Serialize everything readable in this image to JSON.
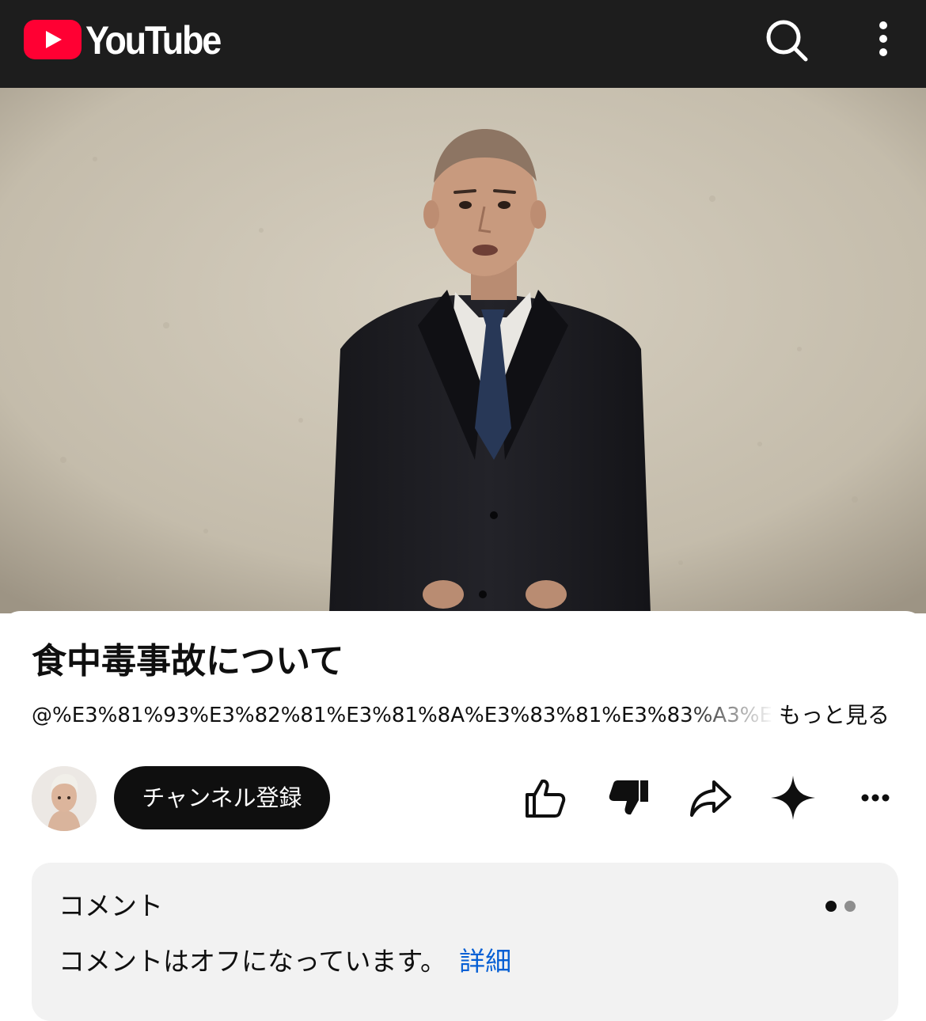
{
  "app": {
    "name": "YouTube",
    "brand_color": "#ff0033",
    "icons": [
      "youtube-play-icon",
      "search-icon",
      "more-vert-icon"
    ]
  },
  "video": {
    "title": "食中毒事故について",
    "channel_handle": "@%E3%81%93%E3%82%81%E3%81%8A%E3%83%81%E3%83%A3%E3",
    "more_label": "もっと見る"
  },
  "actions": {
    "subscribe_label": "チャンネル登録",
    "subscribe_color": "#0f0f0f",
    "icons": [
      "thumbs-up-icon",
      "thumbs-down-icon",
      "share-icon",
      "sparkle-icon",
      "more-horiz-icon"
    ]
  },
  "comments": {
    "heading": "コメント",
    "off_message": "コメントはオフになっています。",
    "details_link": "詳細",
    "link_color": "#065fd4"
  }
}
